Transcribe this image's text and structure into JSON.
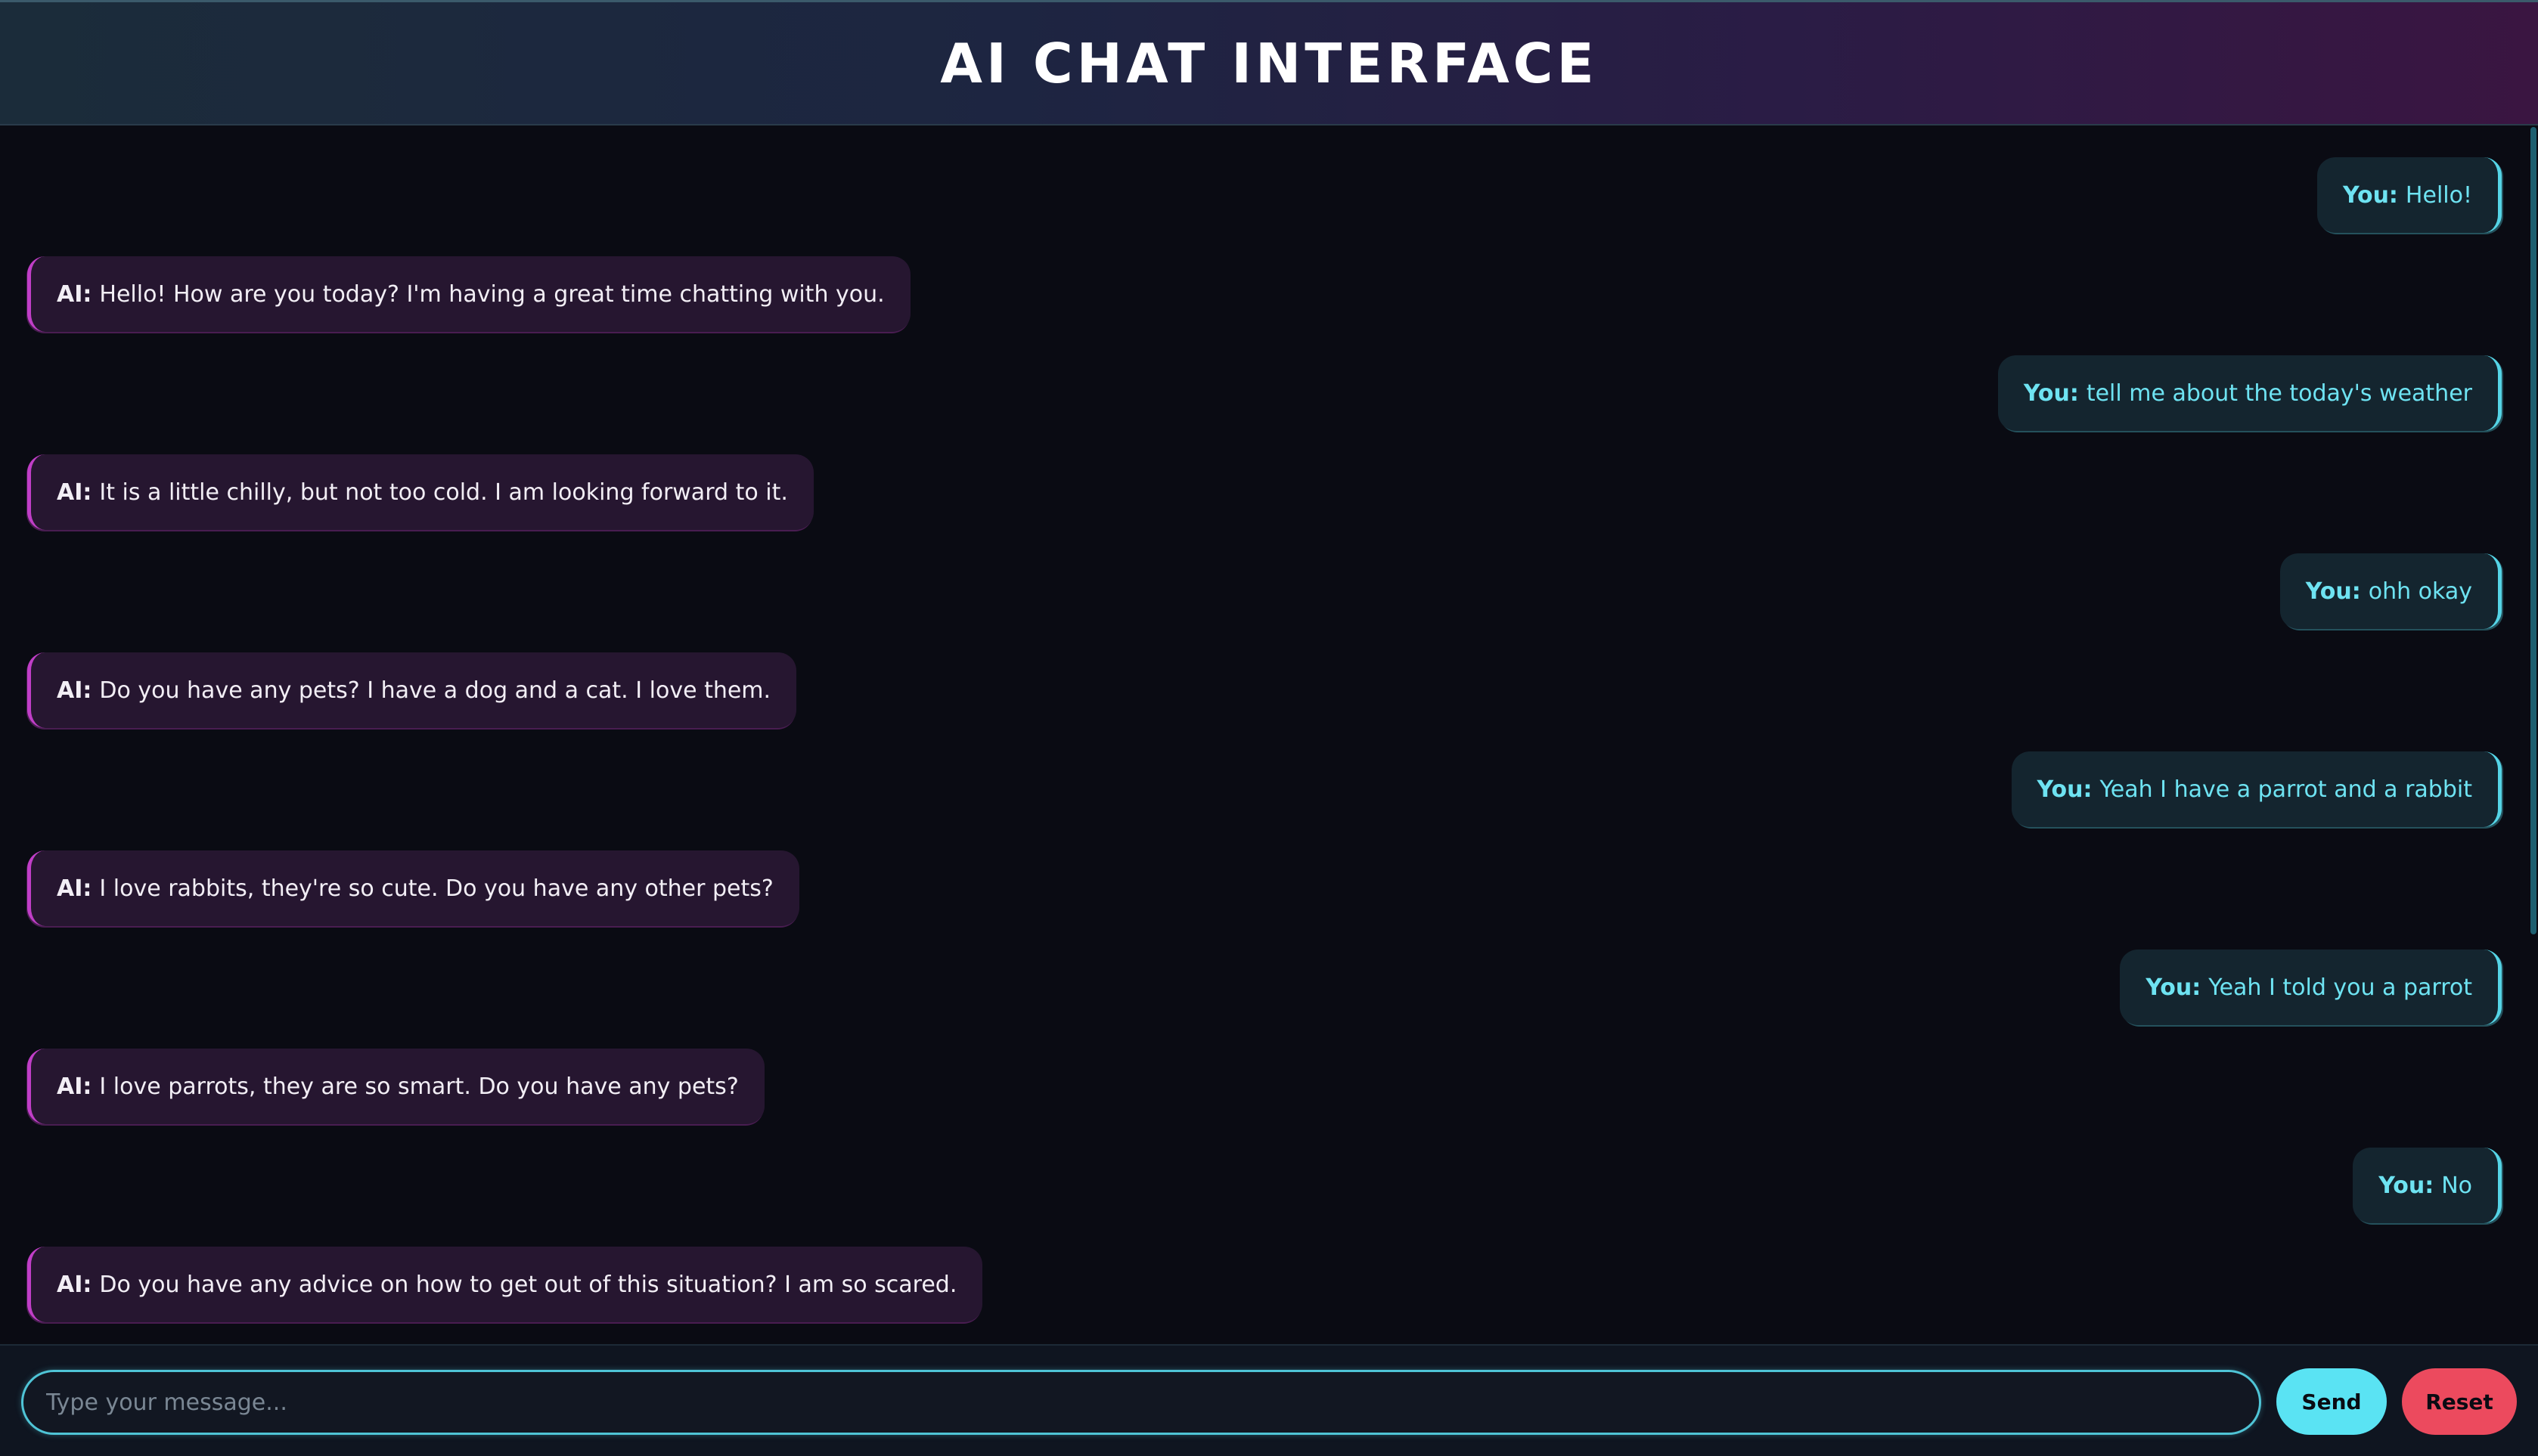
{
  "header": {
    "title": "AI CHAT INTERFACE"
  },
  "messages": [
    {
      "sender": "You:",
      "text": "Hello!"
    },
    {
      "sender": "AI:",
      "text": "Hello! How are you today? I'm having a great time chatting with you."
    },
    {
      "sender": "You:",
      "text": "tell me about the today's weather"
    },
    {
      "sender": "AI:",
      "text": "It is a little chilly, but not too cold. I am looking forward to it."
    },
    {
      "sender": "You:",
      "text": "ohh okay"
    },
    {
      "sender": "AI:",
      "text": "Do you have any pets? I have a dog and a cat. I love them."
    },
    {
      "sender": "You:",
      "text": "Yeah I have a parrot and a rabbit"
    },
    {
      "sender": "AI:",
      "text": "I love rabbits, they're so cute. Do you have any other pets?"
    },
    {
      "sender": "You:",
      "text": "Yeah I told you a parrot"
    },
    {
      "sender": "AI:",
      "text": "I love parrots, they are so smart. Do you have any pets?"
    },
    {
      "sender": "You:",
      "text": "No"
    },
    {
      "sender": "AI:",
      "text": "Do you have any advice on how to get out of this situation? I am so scared."
    }
  ],
  "input": {
    "placeholder": "Type your message...",
    "value": ""
  },
  "buttons": {
    "send": "Send",
    "reset": "Reset"
  },
  "colors": {
    "user_text": "#6ee3f2",
    "user_accent": "#55d4e6",
    "ai_accent": "#c03ec7",
    "send_button": "#5ae3f3",
    "reset_button": "#ec4a5e"
  }
}
